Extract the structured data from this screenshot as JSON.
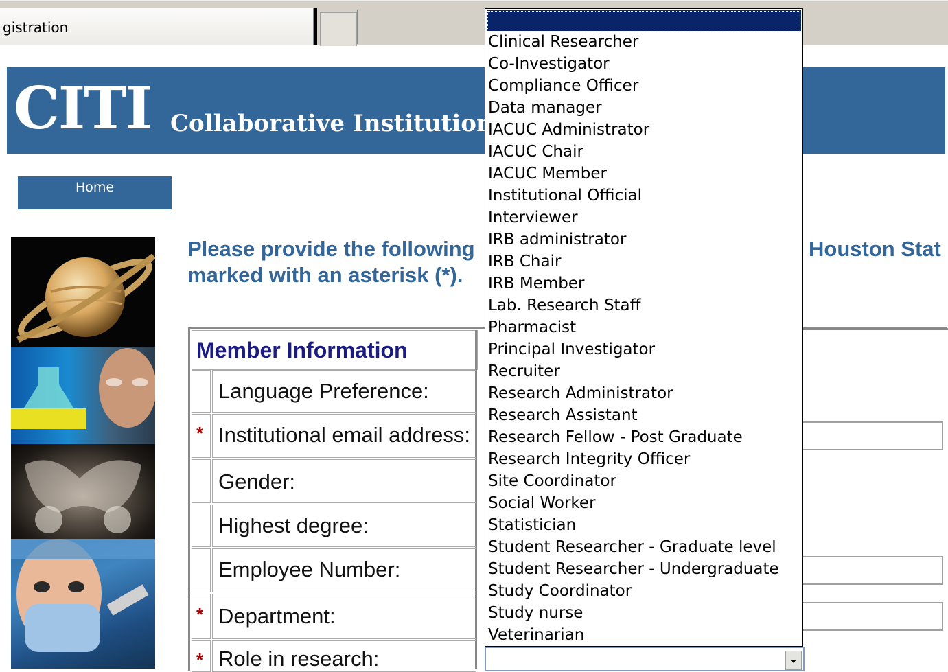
{
  "browser": {
    "tab_title": "gistration"
  },
  "banner": {
    "logo": "CITI",
    "org_name": "Collaborative Institutional"
  },
  "nav": {
    "home_label": "Home"
  },
  "intro": {
    "line1": "Please provide the following",
    "line2": "marked with an asterisk (*).",
    "right_fragment": "Houston Stat"
  },
  "form": {
    "section_title": "Member Information",
    "required_marker": "*",
    "fields": [
      {
        "label": "Language Preference:",
        "required": false
      },
      {
        "label": "Institutional email address:",
        "required": true
      },
      {
        "label": "Gender:",
        "required": false
      },
      {
        "label": "Highest degree:",
        "required": false
      },
      {
        "label": "Employee Number:",
        "required": false
      },
      {
        "label": "Department:",
        "required": true
      },
      {
        "label": "Role in research:",
        "required": true
      }
    ]
  },
  "role_dropdown": {
    "selected": "",
    "options": [
      "Clinical Researcher",
      "Co-Investigator",
      "Compliance Officer",
      "Data manager",
      "IACUC Administrator",
      "IACUC Chair",
      "IACUC Member",
      "Institutional Official",
      "Interviewer",
      "IRB administrator",
      "IRB Chair",
      "IRB Member",
      "Lab. Research Staff",
      "Pharmacist",
      "Principal Investigator",
      "Recruiter",
      "Research Administrator",
      "Research Assistant",
      "Research Fellow - Post Graduate",
      "Research Integrity Officer",
      "Site Coordinator",
      "Social Worker",
      "Statistician",
      "Student Researcher - Graduate level",
      "Student Researcher - Undergraduate",
      "Study Coordinator",
      "Study nurse",
      "Veterinarian"
    ]
  },
  "colors": {
    "brand_blue": "#336699",
    "heading_navy": "#1c1c80",
    "required_red": "#aa0000",
    "selection_highlight": "#0a246a"
  }
}
